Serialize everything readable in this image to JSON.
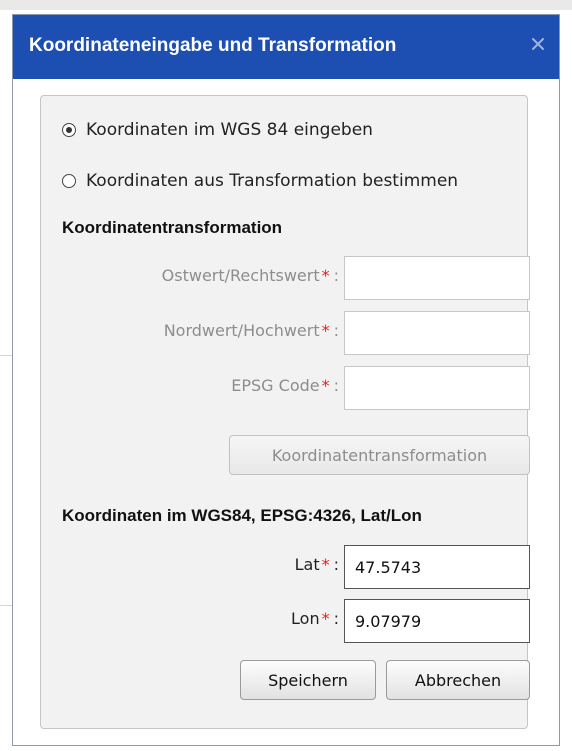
{
  "dialog": {
    "title": "Koordinateneingabe und Transformation",
    "close_icon": "close-icon"
  },
  "mode": {
    "options": [
      {
        "label": "Koordinaten im WGS 84 eingeben",
        "selected": true
      },
      {
        "label": "Koordinaten aus Transformation bestimmen",
        "selected": false
      }
    ]
  },
  "transformation": {
    "heading": "Koordinatentransformation",
    "fields": [
      {
        "label": "Ostwert/Rechtswert",
        "required": "*",
        "colon": ":",
        "value": ""
      },
      {
        "label": "Nordwert/Hochwert",
        "required": "*",
        "colon": ":",
        "value": ""
      },
      {
        "label": "EPSG Code",
        "required": "*",
        "colon": ":",
        "value": ""
      }
    ],
    "button_label": "Koordinatentransformation"
  },
  "wgs84": {
    "heading": "Koordinaten im WGS84, EPSG:4326, Lat/Lon",
    "lat": {
      "label": "Lat",
      "required": "*",
      "colon": ":",
      "value": "47.5743"
    },
    "lon": {
      "label": "Lon",
      "required": "*",
      "colon": ":",
      "value": "9.07979"
    }
  },
  "actions": {
    "save_label": "Speichern",
    "cancel_label": "Abbrechen"
  },
  "colors": {
    "titlebar": "#1d4fb2",
    "required_star": "#e02020",
    "panel": "#f2f2f2"
  }
}
